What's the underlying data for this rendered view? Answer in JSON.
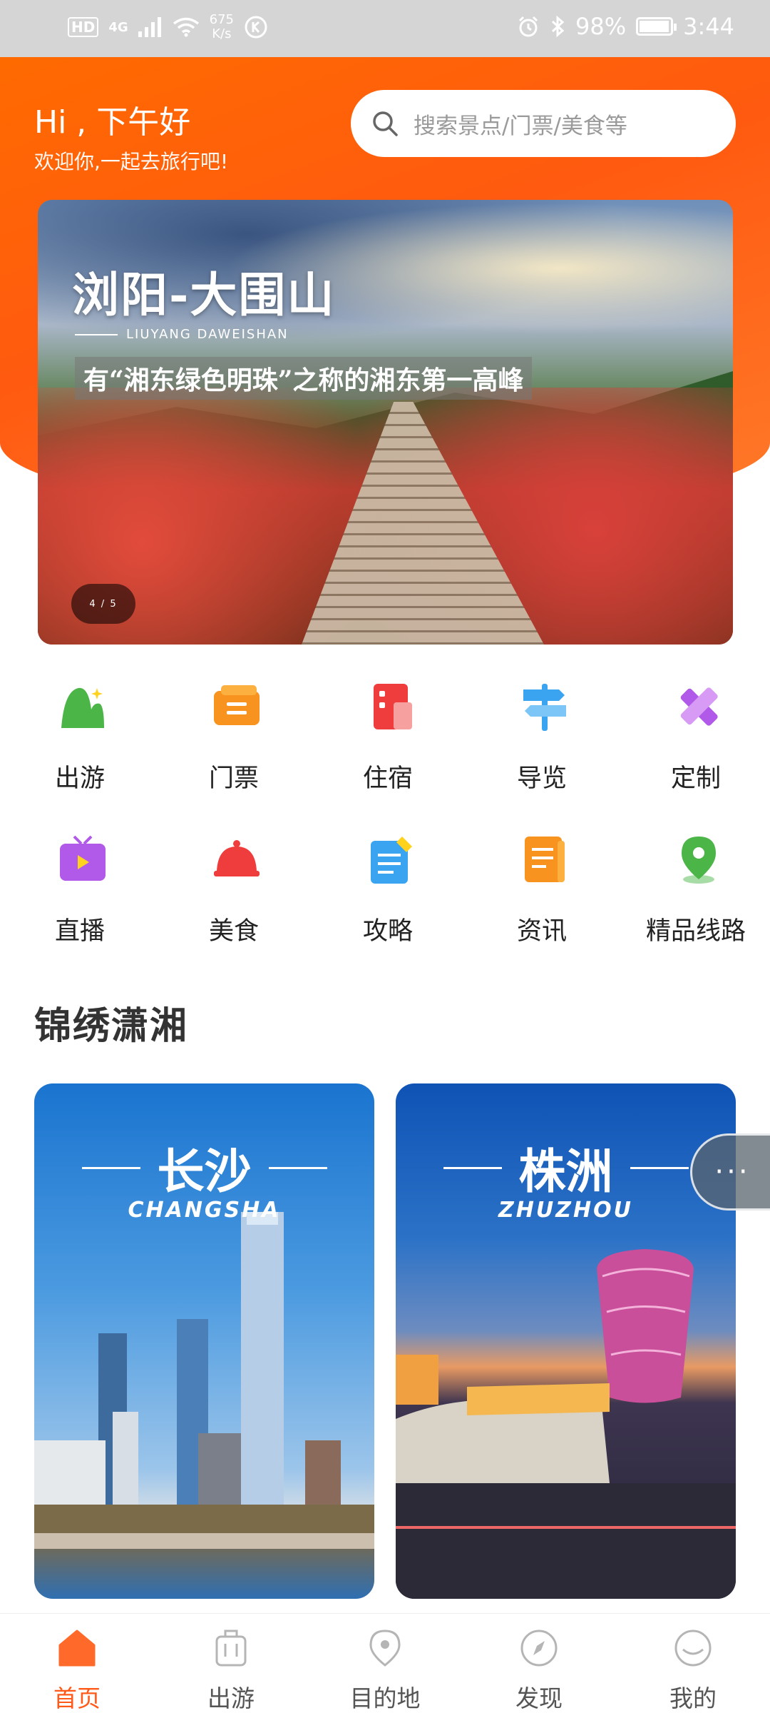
{
  "status_bar": {
    "hd": "HD",
    "network": "4G",
    "net_speed_value": "675",
    "net_speed_unit": "K/s",
    "battery_percent": "98%",
    "battery_level": 0.98,
    "time": "3:44"
  },
  "header": {
    "greeting": "Hi , 下午好",
    "subtitle": "欢迎你,一起去旅行吧!",
    "search_placeholder": "搜索景点/门票/美食等"
  },
  "banner": {
    "title": "浏阳-大围山",
    "title_en": "LIUYANG DAWEISHAN",
    "subtitle": "有“湘东绿色明珠”之称的湘东第一高峰",
    "page_indicator": "4 / 5"
  },
  "quick_menu": [
    {
      "label": "出游",
      "icon": "mountain-icon",
      "color": "#4cb548"
    },
    {
      "label": "门票",
      "icon": "ticket-icon",
      "color": "#f7931e"
    },
    {
      "label": "住宿",
      "icon": "hotel-icon",
      "color": "#ef3d3d"
    },
    {
      "label": "导览",
      "icon": "signpost-icon",
      "color": "#3ba4f0"
    },
    {
      "label": "定制",
      "icon": "pencil-ruler-icon",
      "color": "#b159e8"
    },
    {
      "label": "直播",
      "icon": "tv-icon",
      "color": "#b159e8"
    },
    {
      "label": "美食",
      "icon": "food-cloche-icon",
      "color": "#ef3d3d"
    },
    {
      "label": "攻略",
      "icon": "notepad-icon",
      "color": "#3ba4f0"
    },
    {
      "label": "资讯",
      "icon": "document-icon",
      "color": "#f7931e"
    },
    {
      "label": "精品线路",
      "icon": "location-pin-icon",
      "color": "#4cb548"
    }
  ],
  "section": {
    "title": "锦绣潇湘",
    "cities": [
      {
        "name": "长沙",
        "name_en": "CHANGSHA"
      },
      {
        "name": "株洲",
        "name_en": "ZHUZHOU"
      }
    ]
  },
  "more_button": "···",
  "bottom_nav": [
    {
      "label": "首页",
      "icon": "home-icon",
      "active": true
    },
    {
      "label": "出游",
      "icon": "luggage-icon",
      "active": false
    },
    {
      "label": "目的地",
      "icon": "map-pin-icon",
      "active": false
    },
    {
      "label": "发现",
      "icon": "compass-icon",
      "active": false
    },
    {
      "label": "我的",
      "icon": "profile-icon",
      "active": false
    }
  ],
  "colors": {
    "brand": "#ff5a1a",
    "header_gradient_start": "#ff6a00",
    "text_primary": "#222222",
    "inactive_nav": "#b5b5b5"
  }
}
